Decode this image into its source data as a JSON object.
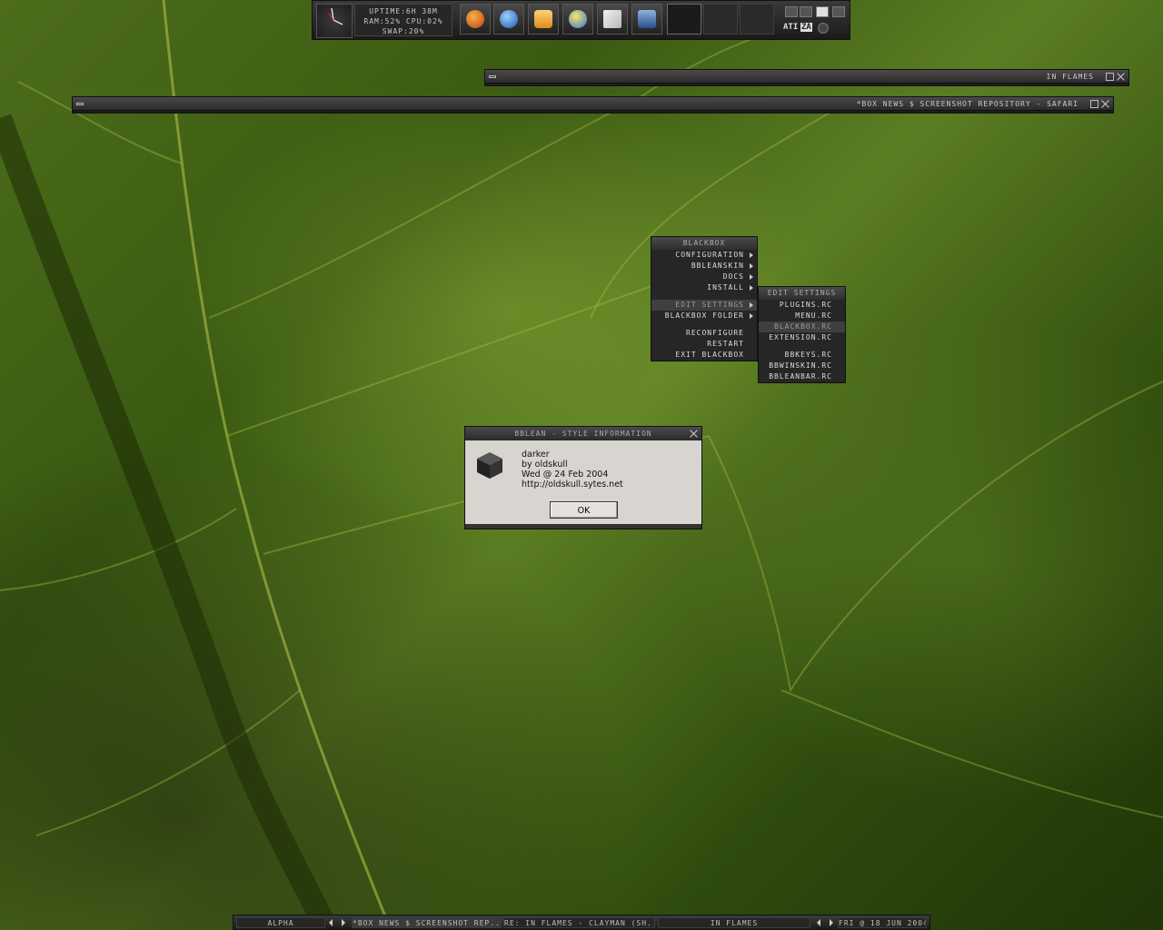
{
  "toolbar": {
    "uptime": "UPTIME:6H 38M",
    "ram_cpu": "RAM:52% CPU:02%",
    "swap": "SWAP:20%",
    "launchers": [
      "firefox-icon",
      "internet-explorer-icon",
      "mail-icon",
      "messenger-icon",
      "notepad-icon",
      "recycle-bin-icon"
    ],
    "tray_label": "ATI",
    "tray_label2": "ZA"
  },
  "windows": {
    "in_flames": {
      "title": "IN FLAMES"
    },
    "safari": {
      "title": "*BOX NEWS $ SCREENSHOT REPOSITORY - SAFARI"
    }
  },
  "menu": {
    "title": "BLACKBOX",
    "items": {
      "configuration": "CONFIGURATION",
      "bbleanskin": "BBLEANSKIN",
      "docs": "DOCS",
      "install": "INSTALL",
      "edit_settings": "EDIT SETTINGS",
      "blackbox_folder": "BLACKBOX FOLDER",
      "reconfigure": "RECONFIGURE",
      "restart": "RESTART",
      "exit_blackbox": "EXIT BLACKBOX"
    }
  },
  "submenu": {
    "title": "EDIT SETTINGS",
    "items": {
      "plugins": "PLUGINS.RC",
      "menu": "MENU.RC",
      "blackbox": "BLACKBOX.RC",
      "extension": "EXTENSION.RC",
      "bbkeys": "BBKEYS.RC",
      "bbwinskin": "BBWINSKIN.RC",
      "bbleanbar": "BBLEANBAR.RC"
    }
  },
  "dialog": {
    "title": "BBLEAN - STYLE INFORMATION",
    "style_name": "darker",
    "author": "by oldskull",
    "date": "Wed @ 24 Feb 2004",
    "url": "http://oldskull.sytes.net",
    "ok_label": "OK"
  },
  "taskbar": {
    "workspace": "ALPHA",
    "task1": "*BOX NEWS $ SCREENSHOT REP...",
    "task2": "RE: IN FLAMES - CLAYMAN (SH...",
    "task3": "IN FLAMES",
    "clock": "FRI @ 18 JUN 2004"
  },
  "colors": {
    "panel": "#262626",
    "title_text": "#aaaaaa",
    "dialog_bg": "#d8d4d0"
  }
}
